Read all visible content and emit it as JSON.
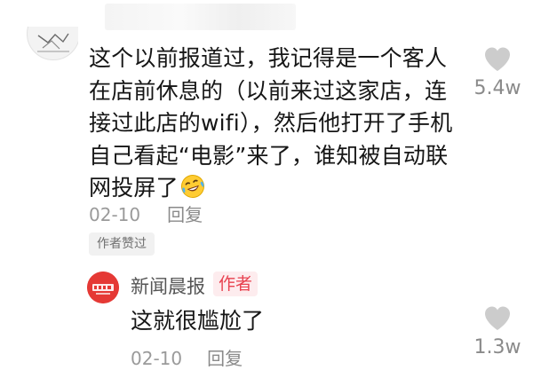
{
  "comment": {
    "lines": [
      "这个以前报道过，我记得是一个客人",
      "在店前休息的（以前来过这家店，连",
      "接过此店的wifi），然后他打开了手机",
      "自己看起“电影”来了，谁知被自动联",
      "网投屏了"
    ],
    "date": "02-10",
    "reply_label": "回复",
    "likes": "5.4w",
    "author_liked_tag": "作者赞过"
  },
  "reply": {
    "username": "新闻晨报",
    "author_badge": "作者",
    "text": "这就很尴尬了",
    "date": "02-10",
    "reply_label": "回复",
    "likes": "1.3w"
  },
  "icons": [
    "heart-icon",
    "laughing-crying-emoji",
    "avatar"
  ],
  "colors": {
    "badge_text": "#e8414f",
    "badge_bg": "#fdecee",
    "meta_gray": "#9a9a9a",
    "heart": "#cccccc"
  }
}
